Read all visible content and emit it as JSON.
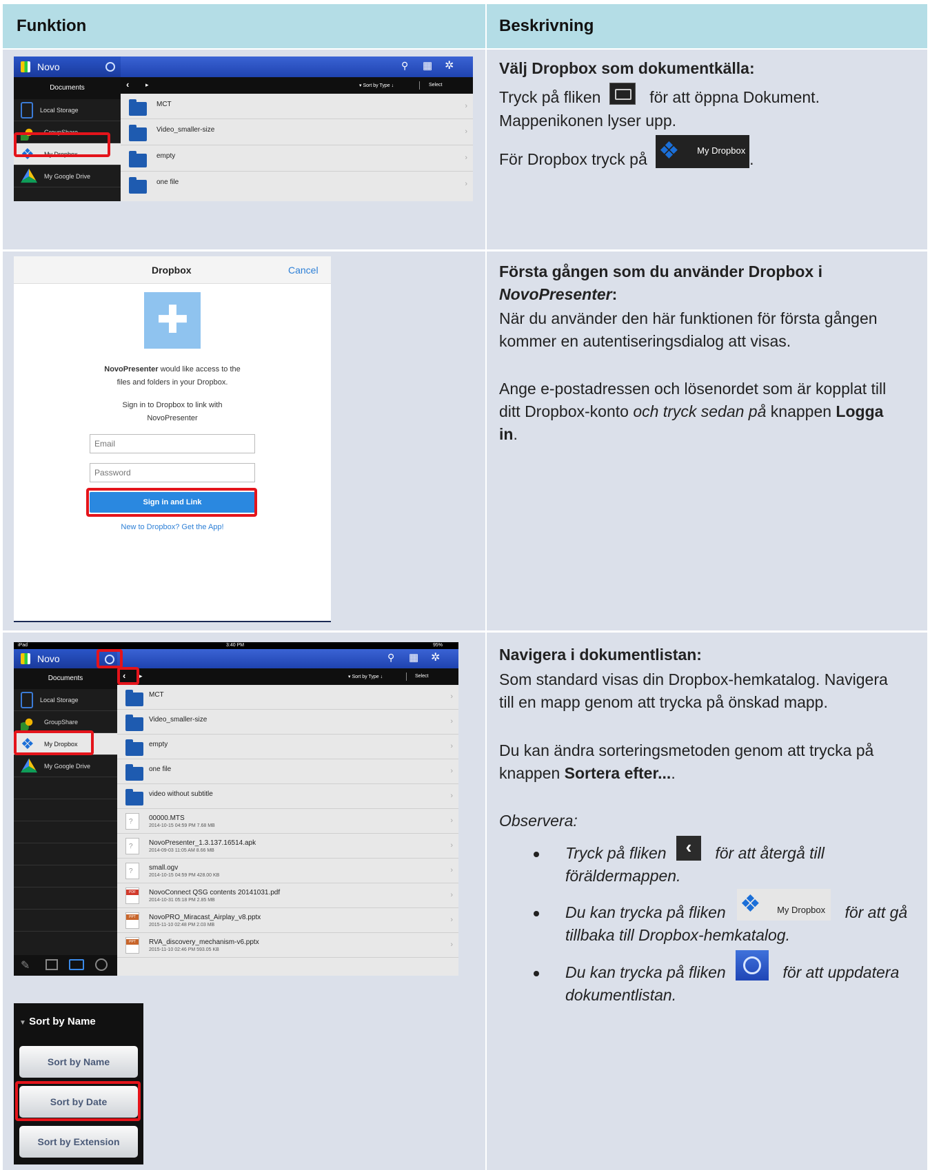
{
  "header": {
    "col1": "Funktion",
    "col2": "Beskrivning"
  },
  "app": {
    "brand": "Novo",
    "documents": "Documents",
    "sort_by_type": "Sort by Type",
    "select": "Select",
    "sources": [
      "Local Storage",
      "GroupShare",
      "My Dropbox",
      "My Google Drive"
    ],
    "folders1": [
      "MCT",
      "Video_smaller-size",
      "empty",
      "one file"
    ],
    "status_left": "iPad",
    "status_time": "3:40 PM",
    "status_battery": "95%",
    "folders3": [
      "MCT",
      "Video_smaller-size",
      "empty",
      "one file",
      "video without subtitle"
    ],
    "files3": [
      {
        "name": "00000.MTS",
        "meta": "2014-10-15 04:59 PM   7.68 MB",
        "tag": ""
      },
      {
        "name": "NovoPresenter_1.3.137.16514.apk",
        "meta": "2014-09-03 11:05 AM   8.66 MB",
        "tag": ""
      },
      {
        "name": "small.ogv",
        "meta": "2014-10-15 04:59 PM   428.00 KB",
        "tag": ""
      },
      {
        "name": "NovoConnect QSG contents 20141031.pdf",
        "meta": "2014-10-31 05:18 PM   2.85 MB",
        "tag": "PDF"
      },
      {
        "name": "NovoPRO_Miracast_Airplay_v8.pptx",
        "meta": "2015-11-10 02:48 PM   2.03 MB",
        "tag": "PPT"
      },
      {
        "name": "RVA_discovery_mechanism-v6.pptx",
        "meta": "2015-11-10 02:46 PM   593.05 KB",
        "tag": "PPT"
      }
    ]
  },
  "dropbox_dialog": {
    "title": "Dropbox",
    "cancel": "Cancel",
    "msg_app": "NovoPresenter",
    "msg_rest": " would like access to the",
    "msg_line2": "files and folders in your Dropbox.",
    "sign_line1": "Sign in to Dropbox to link with",
    "sign_line2": "NovoPresenter",
    "email_placeholder": "Email",
    "password_placeholder": "Password",
    "button": "Sign in and Link",
    "link": "New to Dropbox? Get the App!"
  },
  "sort_menu": {
    "current": "Sort by Name",
    "options": [
      "Sort by Name",
      "Sort by Date",
      "Sort by Extension"
    ]
  },
  "desc1": {
    "title": "Välj Dropbox som dokumentkälla:",
    "l1a": "Tryck på fliken ",
    "l1b": " för att öppna Dokument.",
    "l2": "Mappenikonen lyser upp.",
    "l3": "För Dropbox tryck på ",
    "l3end": ".",
    "badge": "My Dropbox"
  },
  "desc2": {
    "title1": "Första gången som du använder Dropbox i",
    "title2": "NovoPresenter",
    "title2b": ":",
    "p1a": "När du använder den här funktionen för första gången",
    "p1b": "kommer en autentiseringsdialog att visas.",
    "p2a": "Ange e-postadressen och lösenordet som är kopplat till",
    "p2b1": "ditt Dropbox-konto ",
    "p2b2": "och tryck sedan på",
    "p2b3": " knappen ",
    "p2b4": "Logga",
    "p2c": "in",
    "p2c2": "."
  },
  "desc3": {
    "title": "Navigera i dokumentlistan:",
    "p1a": "Som standard visas din Dropbox-hemkatalog. Navigera",
    "p1b": "till en mapp genom att trycka på önskad mapp.",
    "p2a": "Du kan ändra sorteringsmetoden genom att trycka på",
    "p2b1": "knappen ",
    "p2b2": "Sortera efter...",
    "p2b3": ".",
    "note": "Observera:",
    "b1a": "Tryck på fliken ",
    "b1b": " för att återgå till",
    "b1c": "föräldermappen.",
    "b2a": "Du kan trycka på fliken ",
    "b2b": " för att gå",
    "b2c": "tillbaka till Dropbox-hemkatalog.",
    "b3a": "Du kan trycka på fliken ",
    "b3b": " för att uppdatera",
    "b3c": "dokumentlistan.",
    "badge": "My Dropbox"
  }
}
